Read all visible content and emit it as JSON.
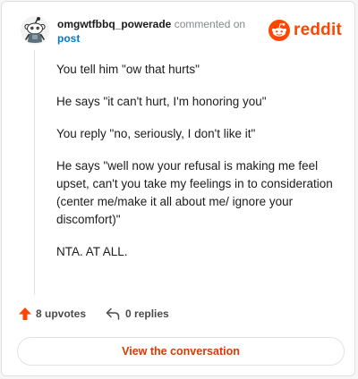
{
  "header": {
    "username": "omgwtfbbq_powerade",
    "commented_on": "commented on",
    "post_link": "post",
    "brand": "reddit"
  },
  "comment": {
    "paragraphs": [
      "You tell him \"ow that hurts\"",
      "He says \"it can't hurt, I'm honoring you\"",
      "You reply \"no, seriously, I don't like it\"",
      "He says \"well now your refusal is making me feel upset, can't you take my feelings in to consideration (center me/make it all about me/ ignore your discomfort)\"",
      "NTA. AT ALL."
    ]
  },
  "actions": {
    "upvotes": "8 upvotes",
    "replies": "0 replies"
  },
  "footer": {
    "view_button": "View the conversation"
  },
  "colors": {
    "brand": "#ff4500",
    "link": "#0079d3",
    "button_text": "#d93a00"
  },
  "icons": {
    "avatar": "snoo-avatar",
    "logo": "reddit-snoo-icon",
    "upvote": "upvote-arrow-icon",
    "reply": "reply-arrow-icon"
  }
}
